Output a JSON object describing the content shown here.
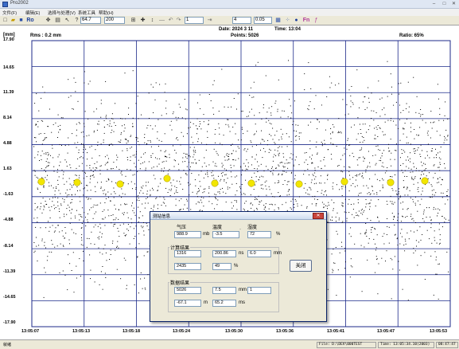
{
  "window": {
    "title": "Pro2002",
    "controls": [
      "–",
      "□",
      "✕"
    ]
  },
  "menu": [
    "文件(F)",
    "编辑(E)",
    "选择与处理(V)",
    "系统工具",
    "帮助(H)"
  ],
  "toolbar": {
    "field_1": "64.7",
    "field_2": "200",
    "field_3": "1",
    "field_4": "4",
    "field_5": "0.05",
    "icons": [
      "new-icon",
      "open-icon",
      "save-icon",
      "ro-icon",
      "move-icon",
      "print-icon",
      "arrow-icon",
      "query-icon",
      "grid-icon",
      "cross-icon",
      "vert-icon",
      "line-icon",
      "undo-icon",
      "redo-icon",
      "zoom-icon",
      "fn-icon"
    ],
    "ro_label": "Ro",
    "fn_label": "Fn"
  },
  "plot": {
    "date_text": "Date: 2024 3 11",
    "time_text": "Time: 13:04",
    "points_text": "Points: 5026",
    "ratio_text": "Ratio: 65%",
    "rms_text": "Rms :  0.2 mm",
    "unit_text": "[mm]",
    "y_ticks": [
      "17.90",
      "14.65",
      "11.39",
      "8.14",
      "4.88",
      "1.63",
      "-1.63",
      "-4.88",
      "-8.14",
      "-11.39",
      "-14.65",
      "-17.90"
    ],
    "x_ticks": [
      "13:05:07",
      "13:05:13",
      "13:05:18",
      "13:05:24",
      "13:05:30",
      "13:05:36",
      "13:05:41",
      "13:05:47",
      "13:05:53"
    ],
    "marker_color": "#f2e600",
    "grid_color": "#1c2a8a"
  },
  "dialog": {
    "title": "测站信息",
    "close_label": "✕",
    "pressure_label": "气压",
    "pressure_value": "988.9",
    "pressure_unit": "mb",
    "temperature_label": "温度",
    "temperature_value": "-3.5",
    "humidity_label": "湿度",
    "humidity_value": "72",
    "humidity_unit": "%",
    "dot_sep": "·",
    "rows_group_title": "计算结果",
    "row1_v1": "1316",
    "row1_v2": "200.86",
    "row1_u2": "ns",
    "row1_v3": "6.0",
    "row1_u3": "mm",
    "row2_v1": "2435",
    "row2_v2": "49",
    "row2_u2": "%",
    "stats_group_title": "数据结果",
    "stats_v1": "5026",
    "stats_v2": "7.5",
    "stats_u2": "mm",
    "stats_v3": "1",
    "stats_v4": "-67.1",
    "stats_u4": "m",
    "stats_v5": "65.2",
    "stats_u5": "ms",
    "close_button": "关闭"
  },
  "status": {
    "left": "就绪",
    "file": "File: D:\\DEV\\000TEST",
    "time": "Time: 13:05:34.10(2003)",
    "clock": "08:47:47"
  }
}
